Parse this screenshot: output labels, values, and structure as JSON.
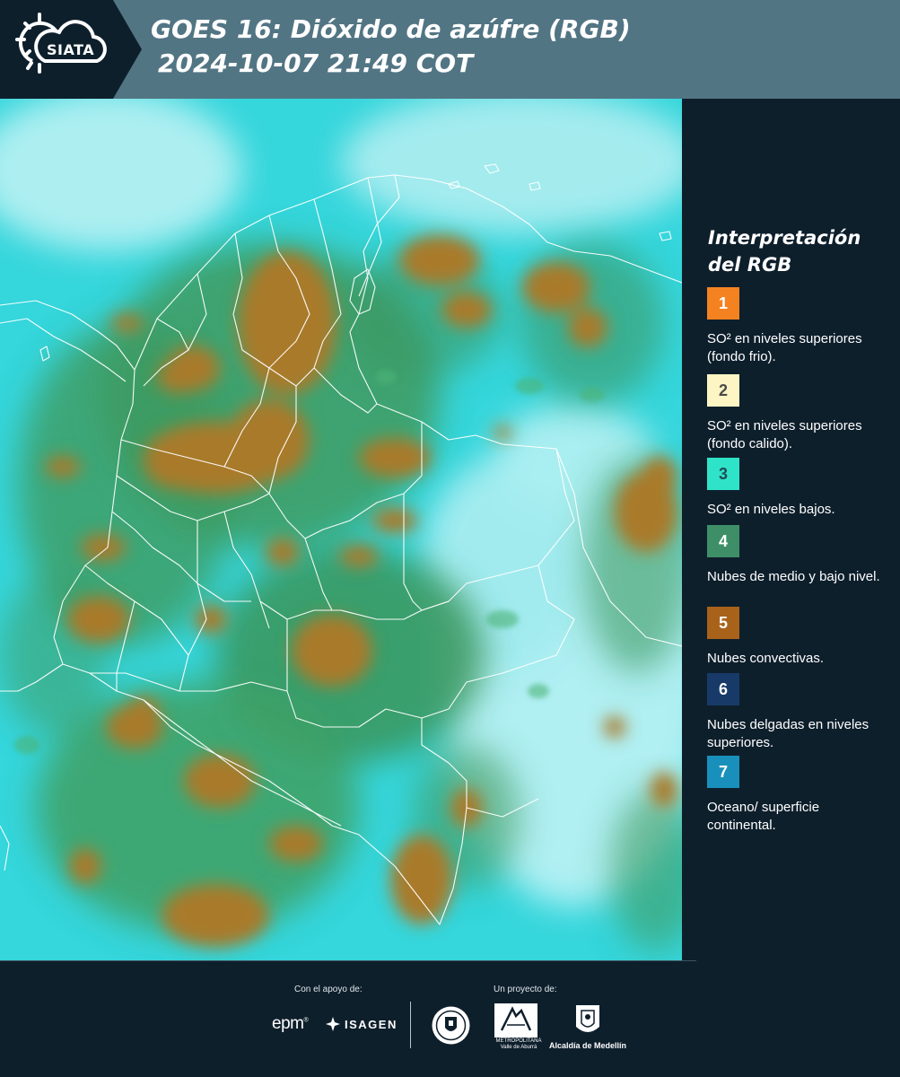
{
  "header": {
    "logo_text": "SIATA",
    "title_line1": "GOES 16: Dióxido de azúfre (RGB)",
    "title_line2": "2024-10-07 21:49 COT"
  },
  "legend": {
    "title_line1": "Interpretación",
    "title_line2": "del RGB",
    "items": [
      {
        "num": "1",
        "color": "#f58220",
        "text_color": "#ffffff",
        "label": "SO² en niveles superiores (fondo frio)."
      },
      {
        "num": "2",
        "color": "#fdf5c3",
        "text_color": "#4a4a4a",
        "label": "SO² en niveles superiores (fondo calido)."
      },
      {
        "num": "3",
        "color": "#2fe3c8",
        "text_color": "#1f4c55",
        "label": "SO² en niveles bajos."
      },
      {
        "num": "4",
        "color": "#3e8f68",
        "text_color": "#ffffff",
        "label": "Nubes de medio y bajo nivel."
      },
      {
        "num": "5",
        "color": "#a8621a",
        "text_color": "#ffffff",
        "label": "Nubes convectivas."
      },
      {
        "num": "6",
        "color": "#173a68",
        "text_color": "#ffffff",
        "label": "Nubes delgadas en niveles superiores."
      },
      {
        "num": "7",
        "color": "#1990bc",
        "text_color": "#ffffff",
        "label": "Oceano/ superficie continental."
      }
    ]
  },
  "footer": {
    "support_label": "Con el apoyo de:",
    "project_label": "Un proyecto de:",
    "epm": "epm",
    "isagen": "ISAGEN",
    "area_text": "METROPOLITANA Valle de Aburrá",
    "alcaldia": "Alcaldía de Medellín"
  }
}
